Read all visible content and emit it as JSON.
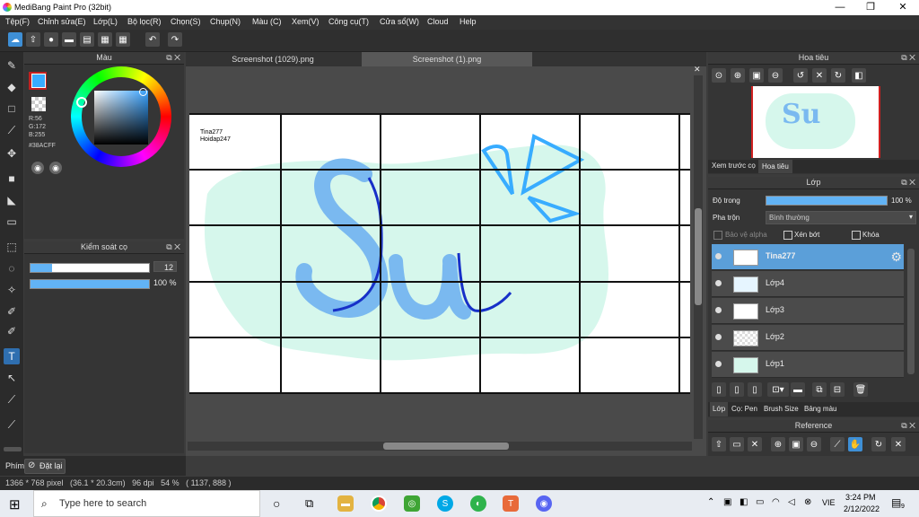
{
  "window": {
    "title": "MediBang Paint Pro (32bit)",
    "minimize": "—",
    "maximize": "❐",
    "close": "✕"
  },
  "menu": [
    "Tệp(F)",
    "Chỉnh sửa(E)",
    "Lớp(L)",
    "Bộ lọc(R)",
    "Chọn(S)",
    "Chụp(N)",
    "Màu (C)",
    "Xem(V)",
    "Công cụ(T)",
    "Cửa sổ(W)",
    "Cloud",
    "Help"
  ],
  "color_panel": {
    "title": "Màu",
    "r": "R:56",
    "g": "G:172",
    "b": "B:255",
    "hex": "#38ACFF",
    "fg_color": "#38acff",
    "bg_color": "#c02020"
  },
  "brush_panel": {
    "title": "Kiểm soát cọ",
    "size": "12",
    "opacity": "100 %",
    "size_fraction": 0.18,
    "opacity_fraction": 1.0
  },
  "tabs": [
    "Screenshot (1029).png",
    "Screenshot (1).png"
  ],
  "canvas": {
    "text_line1": "Tina277",
    "text_line2": "Hoidap247",
    "bg_blob_color": "#d6f7ec",
    "letter_fill": "#7ab9f0",
    "letter_stroke": "#1730c8"
  },
  "navigator": {
    "title": "Hoa tiêu",
    "tab_preview": "Xem trước cọ",
    "tab_nav": "Hoa tiêu"
  },
  "layers": {
    "title": "Lớp",
    "opacity_label": "Độ trong",
    "opacity_value": "100 %",
    "blend_label": "Pha trộn",
    "blend_value": "Bình thường",
    "protect_alpha": "Bảo vệ alpha",
    "clipping": "Xén bớt",
    "lock": "Khóa",
    "items": [
      {
        "name": "Tina277"
      },
      {
        "name": "Lớp4"
      },
      {
        "name": "Lớp3"
      },
      {
        "name": "Lớp2"
      },
      {
        "name": "Lớp1"
      }
    ],
    "bottom_tabs": [
      "Lớp",
      "Cọ: Pen",
      "Brush Size",
      "Bảng màu"
    ]
  },
  "reference": {
    "title": "Reference"
  },
  "left_bottom": {
    "label": "Phím",
    "reset": "Đặt lại"
  },
  "status": {
    "text": "1366 * 768 pixel   (36.1 * 20.3cm)   96 dpi   54 %   ( 1137, 888 )"
  },
  "taskbar": {
    "search_placeholder": "Type here to search",
    "time": "3:24 PM",
    "date": "2/12/2022",
    "lang": "VIE",
    "notif": "9"
  }
}
